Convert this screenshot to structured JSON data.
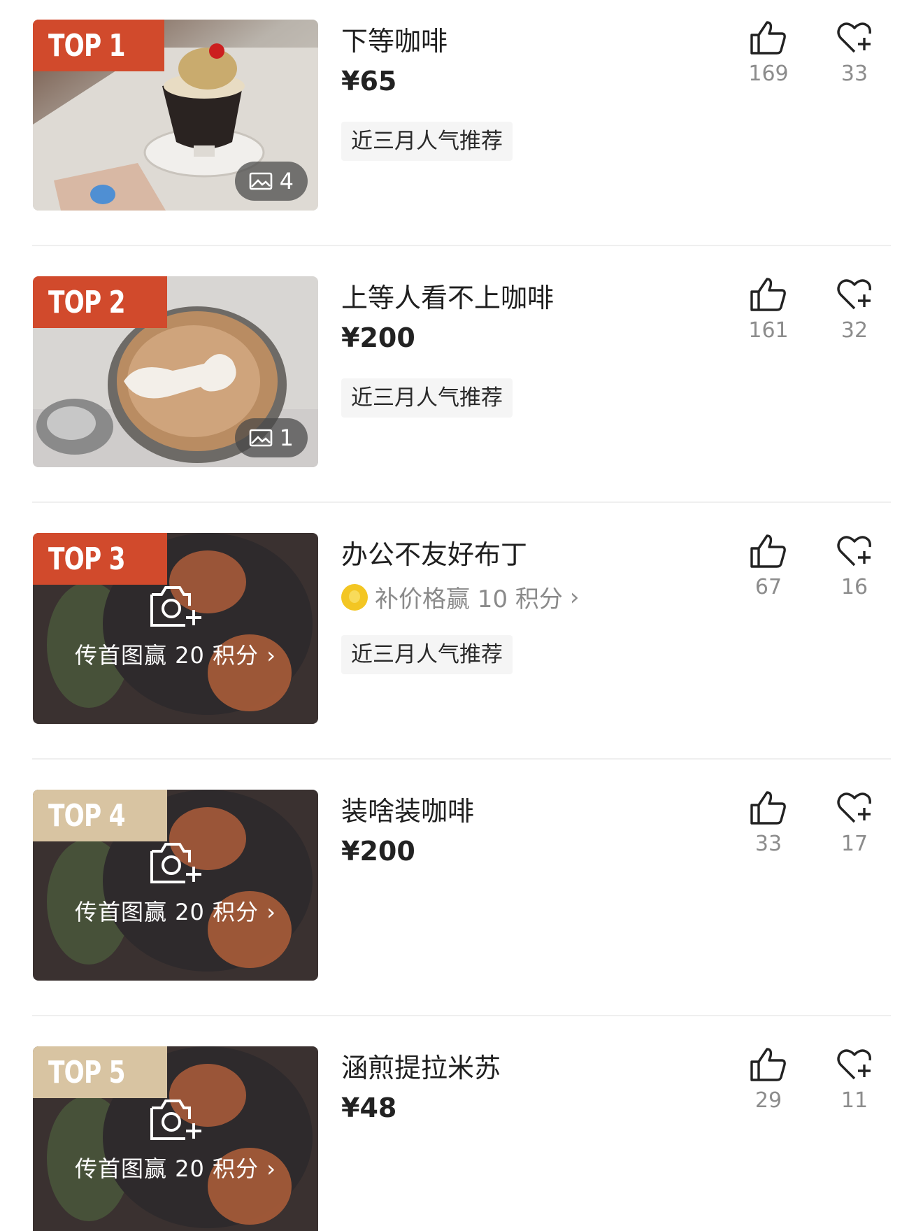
{
  "items": [
    {
      "rank": "TOP 1",
      "rank_style": "hot",
      "title": "下等咖啡",
      "price": "¥65",
      "tag": "近三月人气推荐",
      "photo_count": "4",
      "likes": "169",
      "favorites": "33",
      "thumbnail_icon": "coffee-affogato-photo"
    },
    {
      "rank": "TOP 2",
      "rank_style": "hot",
      "title": "上等人看不上咖啡",
      "price": "¥200",
      "tag": "近三月人气推荐",
      "photo_count": "1",
      "likes": "161",
      "favorites": "32",
      "thumbnail_icon": "latte-art-photo"
    },
    {
      "rank": "TOP 3",
      "rank_style": "hot",
      "title": "办公不友好布丁",
      "bonus": "补价格赢 10 积分",
      "tag": "近三月人气推荐",
      "upload_cta": "传首图赢 20 积分",
      "likes": "67",
      "favorites": "16"
    },
    {
      "rank": "TOP 4",
      "rank_style": "mild",
      "title": "装啥装咖啡",
      "price": "¥200",
      "upload_cta": "传首图赢 20 积分",
      "likes": "33",
      "favorites": "17"
    },
    {
      "rank": "TOP 5",
      "rank_style": "mild",
      "title": "涵煎提拉米苏",
      "price": "¥48",
      "upload_cta": "传首图赢 20 积分",
      "likes": "29",
      "favorites": "11"
    }
  ],
  "colors": {
    "rank_hot": "#d14a2c",
    "rank_mild": "#d8c4a2",
    "count_text": "#8c8c8c",
    "tag_bg": "#f5f5f5"
  },
  "icons": {
    "like": "thumbs-up-icon",
    "favorite": "heart-plus-icon",
    "photo": "image-icon",
    "camera": "camera-plus-icon",
    "chevron": "chevron-right-icon",
    "coin": "coin-icon"
  }
}
